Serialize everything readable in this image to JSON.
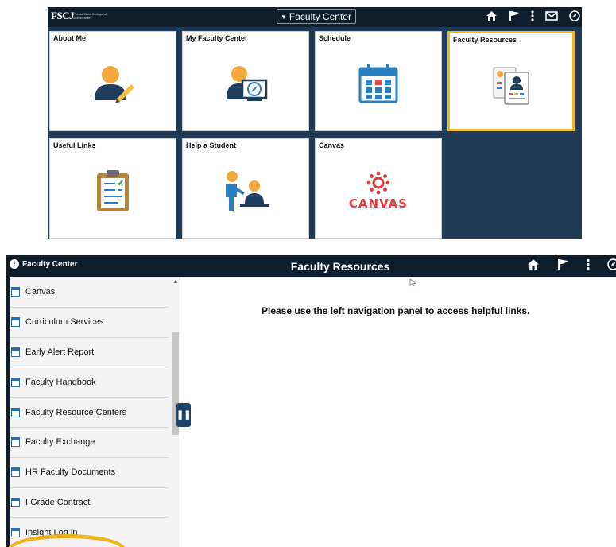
{
  "homepage": {
    "logo": "FSCJ",
    "logo_sub": "Florida State College at Jacksonville",
    "selector": "Faculty Center",
    "tiles": [
      {
        "label": "About Me"
      },
      {
        "label": "My Faculty Center"
      },
      {
        "label": "Schedule"
      },
      {
        "label": "Faculty Resources"
      },
      {
        "label": "Useful Links"
      },
      {
        "label": "Help a Student"
      },
      {
        "label": "Canvas",
        "logo_text": "CANVAS"
      }
    ]
  },
  "page": {
    "back_label": "Faculty Center",
    "title": "Faculty Resources",
    "message": "Please use the left navigation panel to access helpful links.",
    "nav_items": [
      {
        "label": "Canvas"
      },
      {
        "label": "Curriculum Services"
      },
      {
        "label": "Early Alert Report"
      },
      {
        "label": "Faculty Handbook"
      },
      {
        "label": "Faculty Resource Centers"
      },
      {
        "label": "Faculty Exchange"
      },
      {
        "label": "HR Faculty Documents"
      },
      {
        "label": "I Grade Contract"
      },
      {
        "label": "Insight Log in"
      }
    ]
  },
  "colors": {
    "header_bg": "#0f1e2c",
    "homepage_bg": "#1f3a55",
    "highlight": "#f2b21b",
    "canvas_red": "#e13a3a"
  },
  "icons": [
    "home-icon",
    "flag-icon",
    "more-vertical-icon",
    "mail-icon",
    "navbar-icon"
  ]
}
